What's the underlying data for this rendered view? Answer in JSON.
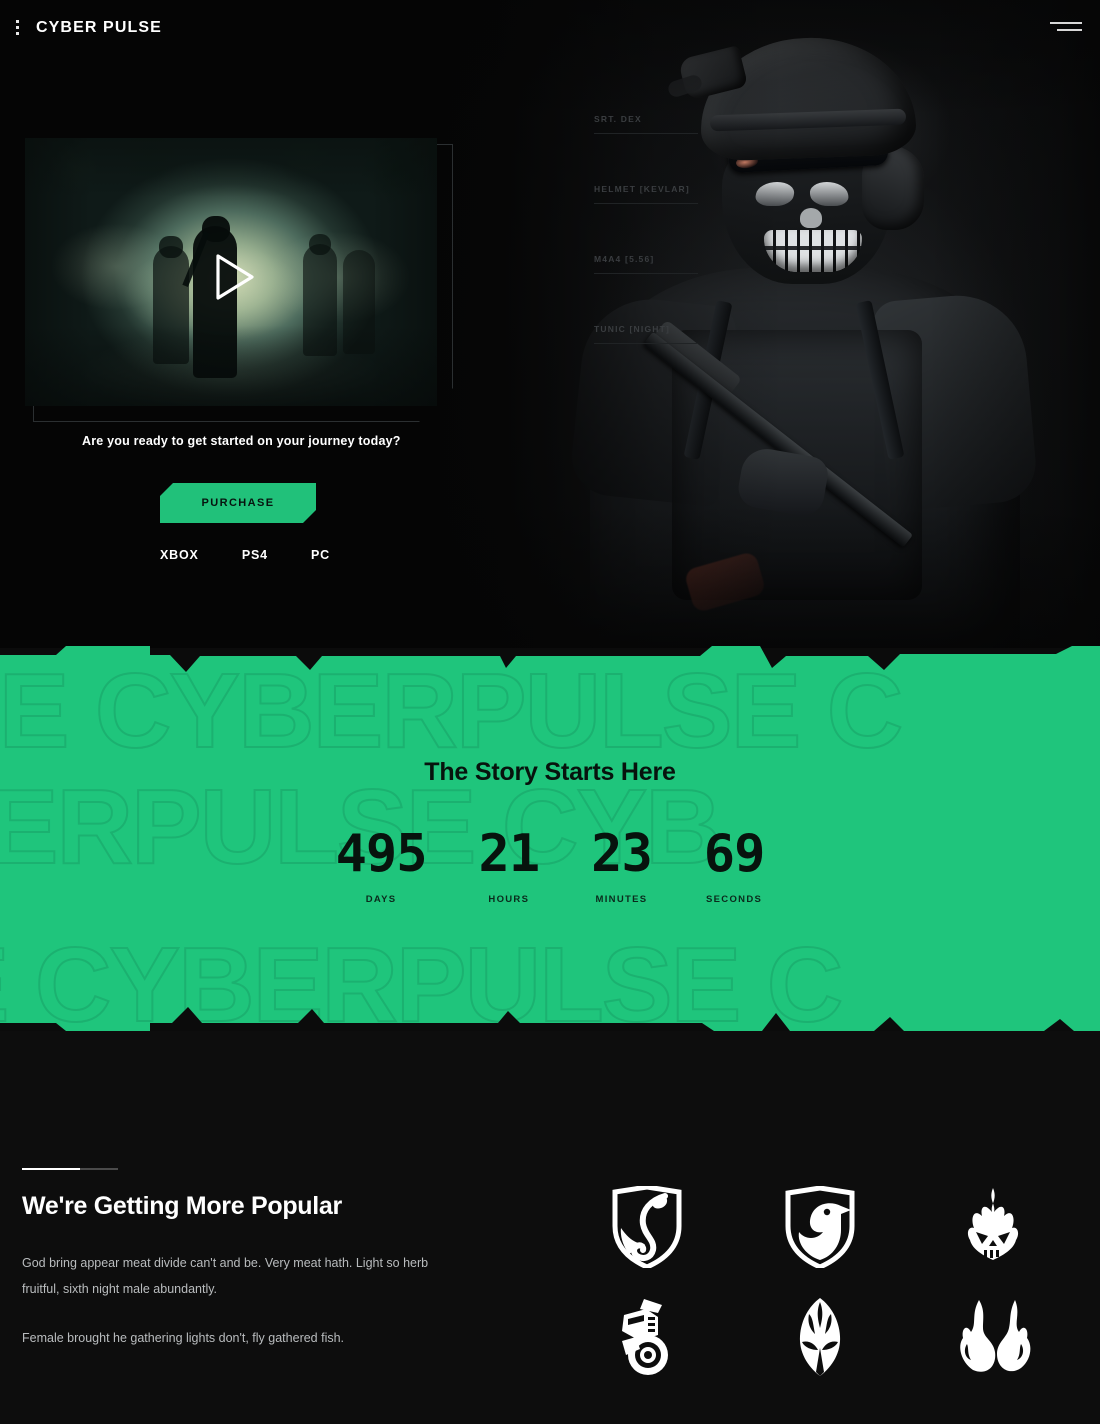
{
  "header": {
    "menu_icon": "vertical-dots-icon",
    "brand": "CYBER PULSE",
    "hamburger_icon": "hamburger-icon"
  },
  "hero": {
    "specs": [
      {
        "label": "SRT. DEX"
      },
      {
        "label": "HELMET [KEVLAR]"
      },
      {
        "label": "M4A4 [5.56]"
      },
      {
        "label": "TUNIC [NIGHT]"
      }
    ],
    "video": {
      "play_icon": "play-icon",
      "alt": "soldiers-in-green-smoke"
    },
    "question": "Are you ready to get started on your journey today?",
    "purchase_label": "PURCHASE",
    "platforms": [
      "XBOX",
      "PS4",
      "PC"
    ],
    "soldier_alt": "masked-soldier-with-rifle"
  },
  "band": {
    "watermark": "SE CYBERPULSE C",
    "watermark2": "CYBERPULSE CYB",
    "watermark3": "SE CYBERPULSE C",
    "title": "The Story Starts Here",
    "countdown": [
      {
        "value": "495",
        "label": "DAYS"
      },
      {
        "value": "21",
        "label": "HOURS"
      },
      {
        "value": "23",
        "label": "MINUTES"
      },
      {
        "value": "69",
        "label": "SECONDS"
      }
    ],
    "accent_color": "#1fc57c"
  },
  "popular": {
    "title": "We're Getting More Popular",
    "paragraph1": "God bring appear meat divide can't and be. Very meat hath. Light so herb fruitful, sixth night male abundantly.",
    "paragraph2": "Female brought he gathering lights don't, fly gathered fish.",
    "logos": [
      {
        "name": "shield-snake-logo"
      },
      {
        "name": "shield-eagle-logo"
      },
      {
        "name": "flame-skull-logo"
      },
      {
        "name": "robot-head-logo"
      },
      {
        "name": "spartan-helmet-logo"
      },
      {
        "name": "twin-flames-logo"
      }
    ]
  },
  "colors": {
    "accent": "#1fc57c",
    "background": "#0b0b0b",
    "text": "#ffffff",
    "muted": "#b9bcbe"
  }
}
